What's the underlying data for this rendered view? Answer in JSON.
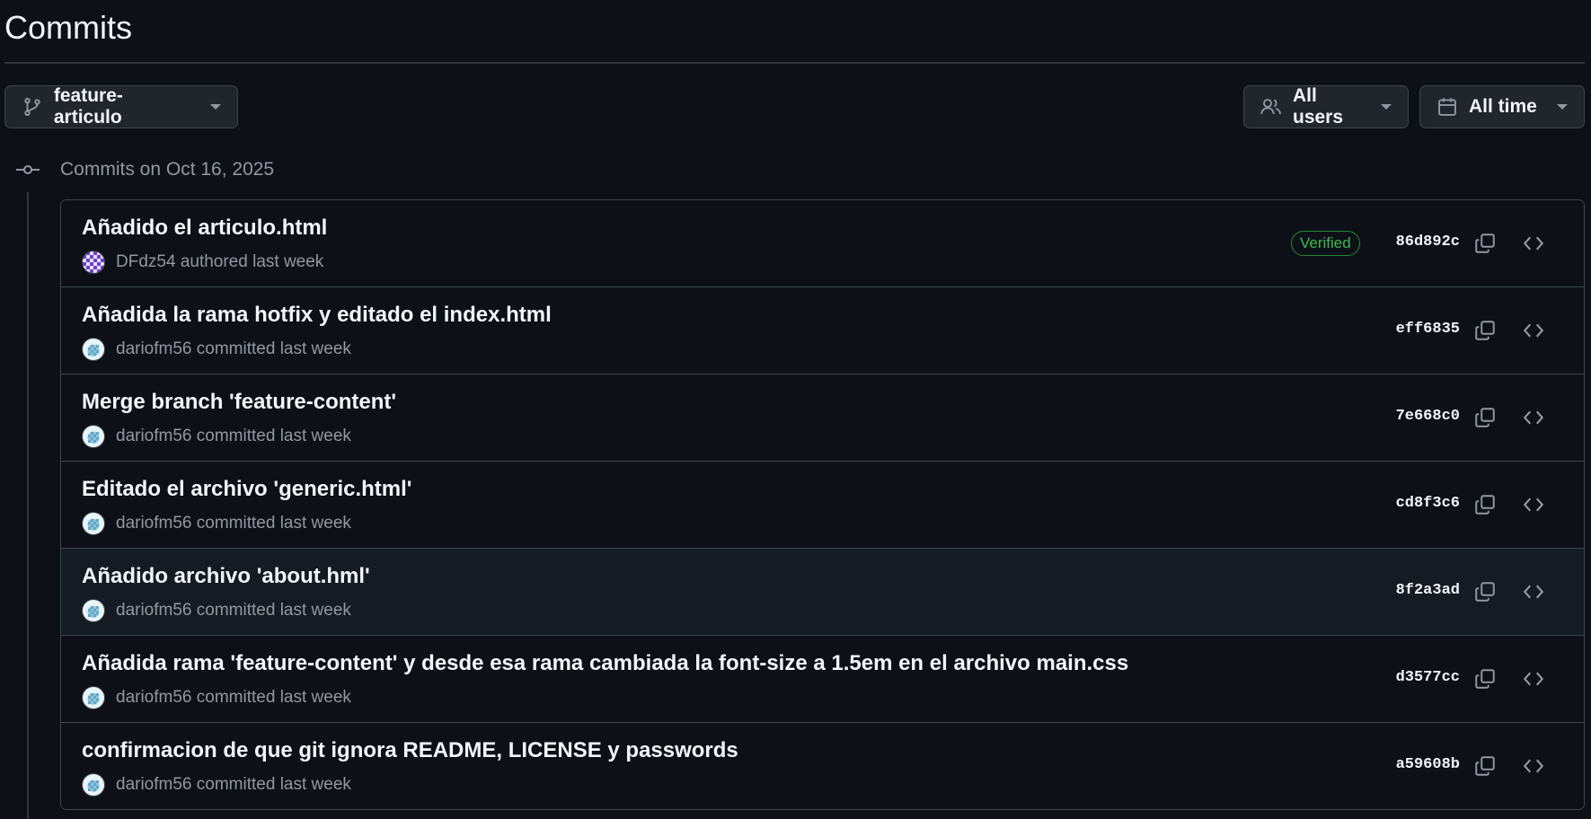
{
  "page": {
    "title": "Commits"
  },
  "filters": {
    "branch": {
      "label": "feature-articulo",
      "icon": "git-branch-icon"
    },
    "users": {
      "label": "All users",
      "icon": "people-icon"
    },
    "time": {
      "label": "All time",
      "icon": "calendar-icon"
    }
  },
  "group": {
    "label": "Commits on Oct 16, 2025",
    "icon": "git-commit-icon"
  },
  "colors": {
    "background": "#0d1117",
    "hover_row": "#151b23",
    "border": "#3d444d",
    "verified_green": "#3fb950",
    "muted_text": "#9198a1"
  },
  "commits": [
    {
      "title": "Añadido el articulo.html",
      "user": "DFdz54",
      "action": "authored last week",
      "sha": "86d892c",
      "verified": "Verified",
      "avatar": "purple"
    },
    {
      "title": "Añadida la rama hotfix y editado el index.html",
      "user": "dariofm56",
      "action": "committed last week",
      "sha": "eff6835",
      "avatar": "teal"
    },
    {
      "title": "Merge branch 'feature-content'",
      "user": "dariofm56",
      "action": "committed last week",
      "sha": "7e668c0",
      "avatar": "teal"
    },
    {
      "title": "Editado el archivo 'generic.html'",
      "user": "dariofm56",
      "action": "committed last week",
      "sha": "cd8f3c6",
      "avatar": "teal"
    },
    {
      "title": "Añadido archivo 'about.hml'",
      "user": "dariofm56",
      "action": "committed last week",
      "sha": "8f2a3ad",
      "avatar": "teal"
    },
    {
      "title": "Añadida rama 'feature-content' y desde esa rama cambiada la font-size a 1.5em en el archivo main.css",
      "user": "dariofm56",
      "action": "committed last week",
      "sha": "d3577cc",
      "avatar": "teal"
    },
    {
      "title": "confirmacion de que git ignora README, LICENSE y passwords",
      "user": "dariofm56",
      "action": "committed last week",
      "sha": "a59608b",
      "avatar": "teal"
    }
  ]
}
